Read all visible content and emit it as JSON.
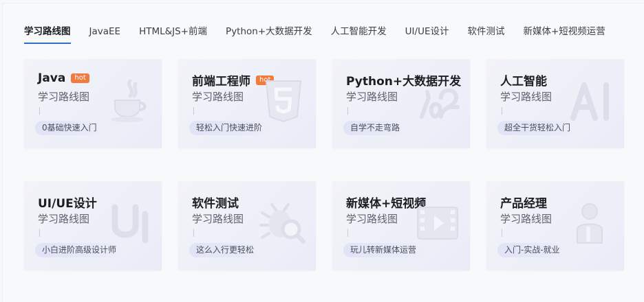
{
  "tabs": [
    {
      "label": "学习路线图",
      "active": true
    },
    {
      "label": "JavaEE",
      "active": false
    },
    {
      "label": "HTML&JS+前端",
      "active": false
    },
    {
      "label": "Python+大数据开发",
      "active": false
    },
    {
      "label": "人工智能开发",
      "active": false
    },
    {
      "label": "UI/UE设计",
      "active": false
    },
    {
      "label": "软件测试",
      "active": false
    },
    {
      "label": "新媒体+短视频运营",
      "active": false
    }
  ],
  "accent_color": "#2e6ec9",
  "hot_color": "#f07b3f",
  "cards": [
    {
      "title": "Java",
      "hot": "hot",
      "subtitle": "学习路线图",
      "tag": "0基础快速入门",
      "icon": "java-cup-icon"
    },
    {
      "title": "前端工程师",
      "hot": "hot",
      "subtitle": "学习路线图",
      "tag": "轻松入门快速进阶",
      "icon": "html5-shield-icon"
    },
    {
      "title": "Python+大数据开发",
      "hot": "",
      "subtitle": "学习路线图",
      "tag": "自学不走弯路",
      "icon": "python-bigdata-icon"
    },
    {
      "title": "人工智能",
      "hot": "",
      "subtitle": "学习路线图",
      "tag": "超全干货轻松入门",
      "icon": "ai-letters-icon"
    },
    {
      "title": "UI/UE设计",
      "hot": "",
      "subtitle": "学习路线图",
      "tag": "小白进阶高级设计师",
      "icon": "ui-letter-icon"
    },
    {
      "title": "软件测试",
      "hot": "",
      "subtitle": "学习路线图",
      "tag": "这么入行更轻松",
      "icon": "bug-magnifier-icon"
    },
    {
      "title": "新媒体+短视频",
      "hot": "",
      "subtitle": "学习路线图",
      "tag": "玩儿转新媒体运营",
      "icon": "video-player-icon"
    },
    {
      "title": "产品经理",
      "hot": "",
      "subtitle": "学习路线图",
      "tag": "入门-实战-就业",
      "icon": "person-icon"
    }
  ]
}
